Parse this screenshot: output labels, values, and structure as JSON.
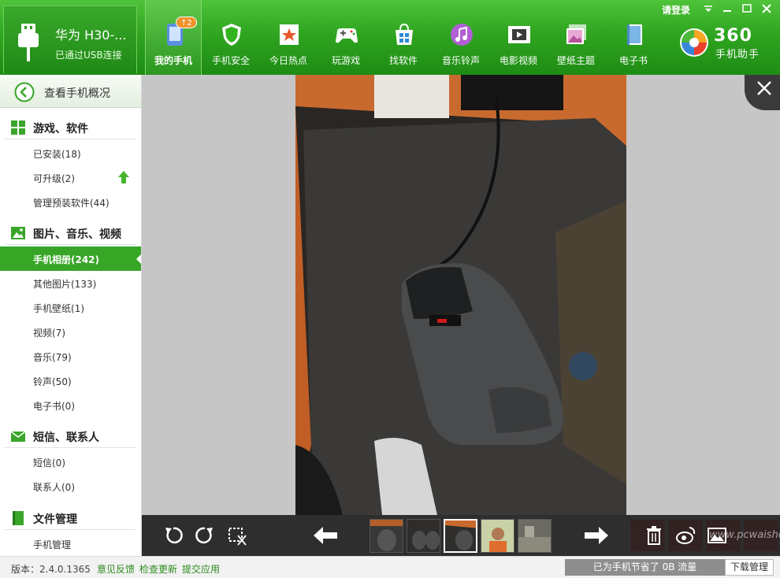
{
  "device": {
    "name": "华为 H30-...",
    "status": "已通过USB连接"
  },
  "nav": {
    "badge": "↑2",
    "items": [
      {
        "label": "我的手机",
        "icon": "phone-icon"
      },
      {
        "label": "手机安全",
        "icon": "shield-icon"
      },
      {
        "label": "今日热点",
        "icon": "hot-star-icon"
      },
      {
        "label": "玩游戏",
        "icon": "gamepad-icon"
      },
      {
        "label": "找软件",
        "icon": "app-store-icon"
      },
      {
        "label": "音乐铃声",
        "icon": "music-icon"
      },
      {
        "label": "电影视频",
        "icon": "film-icon"
      },
      {
        "label": "壁纸主题",
        "icon": "wallpaper-icon"
      },
      {
        "label": "电子书",
        "icon": "book-icon"
      }
    ]
  },
  "window": {
    "login": "请登录"
  },
  "brand": {
    "name": "360",
    "subtitle": "手机助手"
  },
  "sidebar": {
    "overview": "查看手机概况",
    "sections": [
      {
        "title": "游戏、软件",
        "items": [
          "已安装(18)",
          "可升级(2)",
          "管理预装软件(44)"
        ]
      },
      {
        "title": "图片、音乐、视频",
        "items": [
          "手机相册(242)",
          "其他图片(133)",
          "手机壁纸(1)",
          "视频(7)",
          "音乐(79)",
          "铃声(50)",
          "电子书(0)"
        ]
      },
      {
        "title": "短信、联系人",
        "items": [
          "短信(0)",
          "联系人(0)"
        ]
      },
      {
        "title": "文件管理",
        "items": [
          "手机管理"
        ]
      }
    ]
  },
  "viewer": {
    "watermark": "www.pcwaishe.cn"
  },
  "statusbar": {
    "version": "版本：2.4.0.1365",
    "links": [
      "意见反馈",
      "检查更新",
      "提交应用"
    ],
    "traffic": "已为手机节省了 0B 流量",
    "downloads": "下载管理"
  },
  "colors": {
    "brand_green": "#2fa520",
    "selected_green": "#37a627",
    "viewer_bg": "#c6c6c6",
    "toolbar_bg": "#2e2e2e"
  }
}
